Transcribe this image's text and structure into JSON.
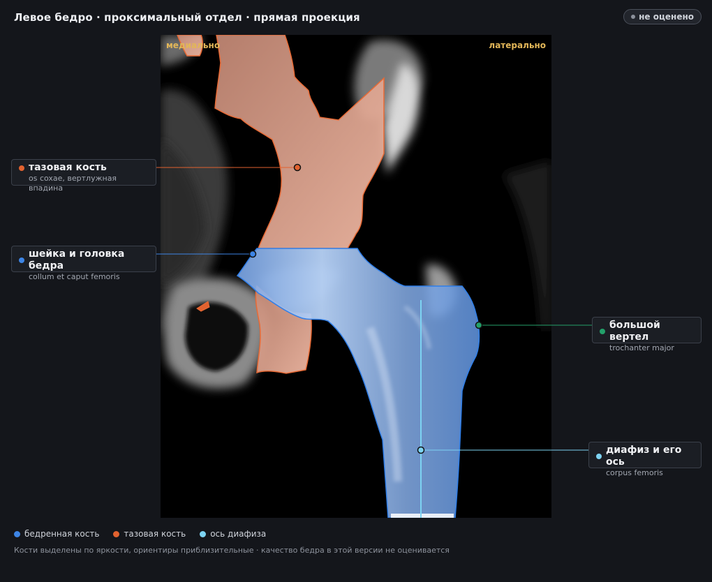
{
  "header": {
    "title": "Левое бедро · проксимальный отдел · прямая проекция",
    "status_label": "не оценено"
  },
  "viewer": {
    "medial_label": "медиально",
    "lateral_label": "латерально"
  },
  "callouts": {
    "pelvis": {
      "name": "тазовая кость",
      "latin": "os coxae, вертлужная впадина",
      "color": "#e2622f"
    },
    "neck": {
      "name": "шейка и головка бедра",
      "latin": "collum et caput femoris",
      "color": "#3d85e6"
    },
    "trochanter": {
      "name": "большой вертел",
      "latin": "trochanter major",
      "color": "#23a06a"
    },
    "shaft": {
      "name": "диафиз и его ось",
      "latin": "corpus femoris",
      "color": "#7dd3f2"
    }
  },
  "legend": {
    "femur": {
      "label": "бедренная кость",
      "color": "#3d85e6"
    },
    "pelvis": {
      "label": "тазовая кость",
      "color": "#e2622f"
    },
    "axis": {
      "label": "ось диафиза",
      "color": "#7dd3f2"
    }
  },
  "footnote": "Кости выделены по яркости, ориентиры приблизительные · качество бедра в этой версии не оценивается"
}
